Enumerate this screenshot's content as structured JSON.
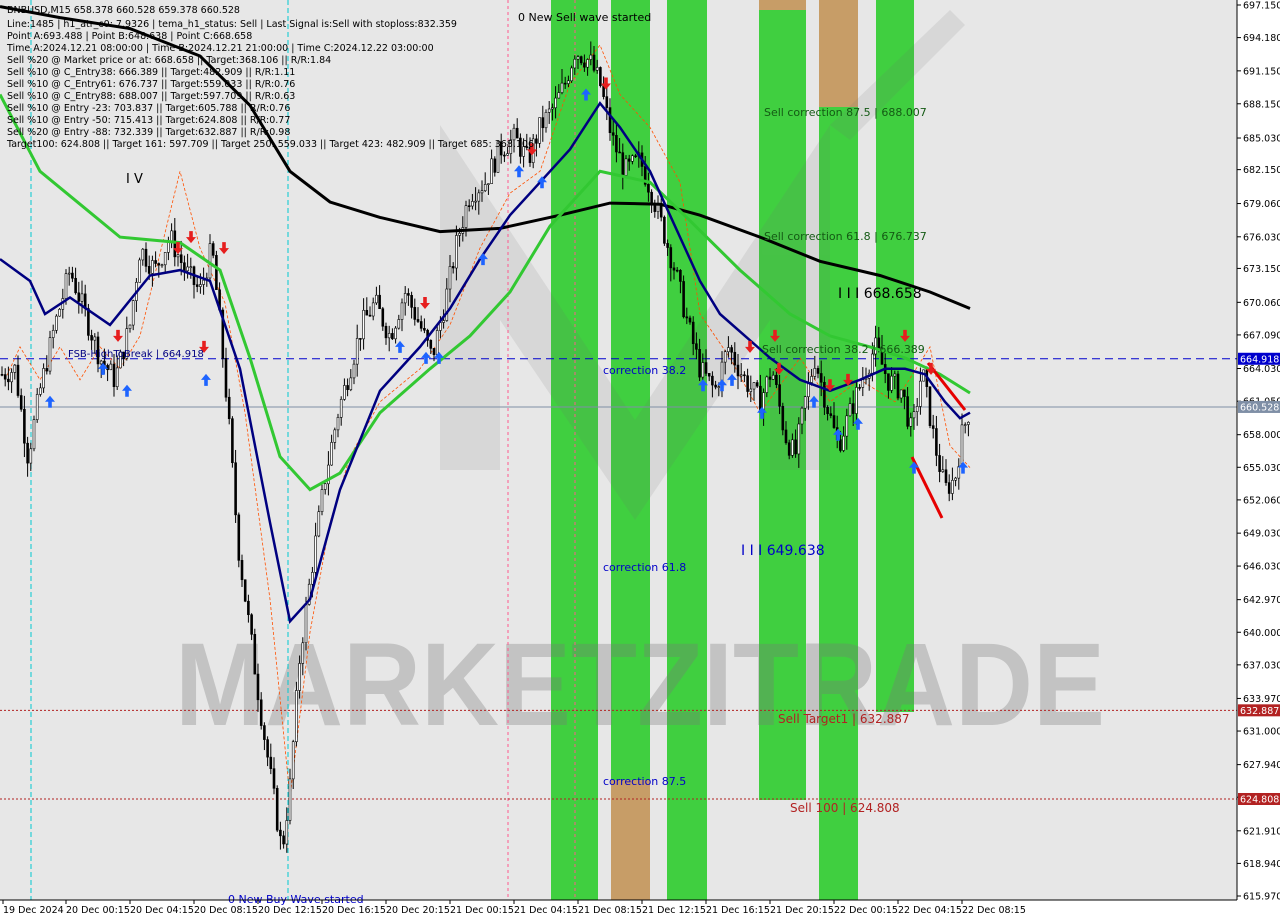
{
  "chart_data": {
    "type": "candlestick",
    "symbol_line": "BNBUSD,M15  658.378 660.528 659.378 660.528",
    "info_lines": [
      "Line:1485 | h1_atr_c0: 7.9326 | tema_h1_status: Sell | Last Signal is:Sell with stoploss:832.359",
      "Point A:693.488 | Point B:648.638 | Point C:668.658",
      "Time A:2024.12.21 08:00:00 | Time B:2024.12.21 21:00:00 | Time C:2024.12.22 03:00:00",
      "Sell %20 @ Market price or at: 668.658 || Target:368.106 || R/R:1.84",
      "Sell %10 @ C_Entry38: 666.389 || Target:482.909 || R/R:1.11",
      "Sell %10 @ C_Entry61: 676.737 || Target:559.033 || R/R:0.76",
      "Sell %10 @ C_Entry88: 688.007 || Target:597.709 || R/R:0.63",
      "Sell %10 @ Entry -23: 703.837 || Target:605.788 || R/R:0.76",
      "Sell %10 @ Entry -50: 715.413 || Target:624.808 || R/R:0.77",
      "Sell %20 @ Entry -88: 732.339 || Target:632.887 || R/R:0.98",
      "Target100: 624.808 || Target 161: 597.709 || Target 250: 559.033 || Target 423: 482.909 || Target 685: 368.106"
    ],
    "y_ticks": [
      "697.150",
      "694.180",
      "691.150",
      "688.150",
      "685.030",
      "682.150",
      "679.060",
      "676.030",
      "673.150",
      "670.060",
      "667.090",
      "664.030",
      "661.050",
      "658.000",
      "655.030",
      "652.060",
      "649.030",
      "646.030",
      "642.970",
      "640.000",
      "637.030",
      "633.970",
      "631.000",
      "627.940",
      "624.970",
      "621.910",
      "618.940",
      "615.970"
    ],
    "y_range": [
      615.97,
      697.15
    ],
    "x_ticks": [
      "19 Dec 2024",
      "20 Dec 00:15",
      "20 Dec 04:15",
      "20 Dec 08:15",
      "20 Dec 12:15",
      "20 Dec 16:15",
      "20 Dec 20:15",
      "21 Dec 00:15",
      "21 Dec 04:15",
      "21 Dec 08:15",
      "21 Dec 12:15",
      "21 Dec 16:15",
      "21 Dec 20:15",
      "22 Dec 00:15",
      "22 Dec 04:15",
      "22 Dec 08:15"
    ],
    "horizontal_lines": [
      {
        "value": 664.918,
        "label": "664.918",
        "color": "#0000cd",
        "style": "dashed"
      },
      {
        "value": 660.528,
        "label": "660.528",
        "color": "#7f8fa6",
        "style": "solid"
      },
      {
        "value": 632.887,
        "label": "632.887",
        "color": "#b22222",
        "style": "dotted"
      },
      {
        "value": 624.808,
        "label": "624.808",
        "color": "#b22222",
        "style": "dotted"
      }
    ],
    "text_annotations": {
      "new_sell": "0 New Sell wave started",
      "new_buy": "0 New Buy Wave started",
      "sell_corr_875": "Sell correction 87.5 | 688.007",
      "sell_corr_618": "Sell correction 61.8 | 676.737",
      "sell_corr_382": "Sell correction 38.2 | 666.389",
      "point_c": "I I I 668.658",
      "point_b": "I I I 649.638",
      "wave_iv": "I V",
      "correction_382": "correction 38.2",
      "correction_618": "correction 61.8",
      "correction_875": "correction 87.5",
      "sell_target1": "Sell Target1 | 632.887",
      "sell_100": "Sell 100 | 624.808",
      "fsb": "FSB-HighToBreak | 664.918",
      "watermark": "MARKETZITRADE"
    },
    "colors": {
      "green_zone": "#32cd32",
      "orange_zone": "#d2996a",
      "ma_green": "#32c832",
      "ma_navy": "#000080",
      "ma_black": "#000000",
      "up_arrow": "#1e64ff",
      "down_arrow": "#e61e1e"
    }
  }
}
